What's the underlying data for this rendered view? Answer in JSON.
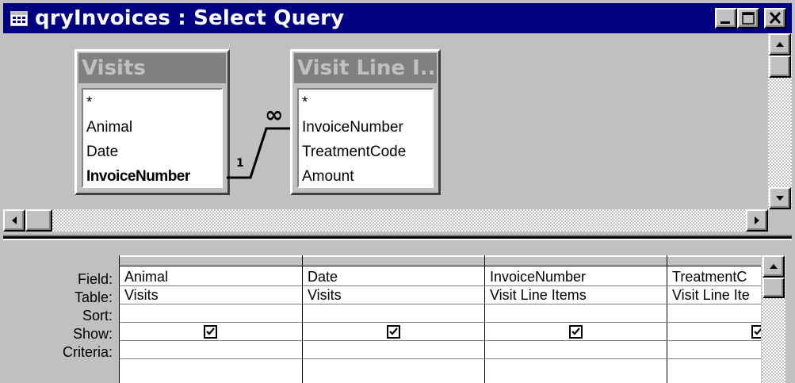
{
  "window": {
    "title": "qryInvoices : Select Query",
    "icon": "query-datasheet-icon",
    "controls": [
      "minimize-icon",
      "maximize-icon",
      "close-icon"
    ]
  },
  "tables": [
    {
      "name": "Visits",
      "fields": [
        "*",
        "Animal",
        "Date",
        "InvoiceNumber"
      ],
      "bold_field": "InvoiceNumber"
    },
    {
      "name": "Visit Line I...",
      "fields": [
        "*",
        "InvoiceNumber",
        "TreatmentCode",
        "Amount"
      ]
    }
  ],
  "relationship": {
    "one_label": "1",
    "many_label": "∞"
  },
  "grid": {
    "row_labels": {
      "field": "Field:",
      "table": "Table:",
      "sort": "Sort:",
      "show": "Show:",
      "criteria": "Criteria:"
    },
    "columns": [
      {
        "field": "Animal",
        "table": "Visits",
        "sort": "",
        "show": true,
        "criteria": ""
      },
      {
        "field": "Date",
        "table": "Visits",
        "sort": "",
        "show": true,
        "criteria": ""
      },
      {
        "field": "InvoiceNumber",
        "table": "Visit Line Items",
        "sort": "",
        "show": true,
        "criteria": ""
      },
      {
        "field": "TreatmentC",
        "table": "Visit Line Ite",
        "sort": "",
        "show": true,
        "criteria": ""
      }
    ]
  },
  "colors": {
    "titlebar": "#000080",
    "face": "#c0c0c0",
    "table_header": "#808080"
  }
}
